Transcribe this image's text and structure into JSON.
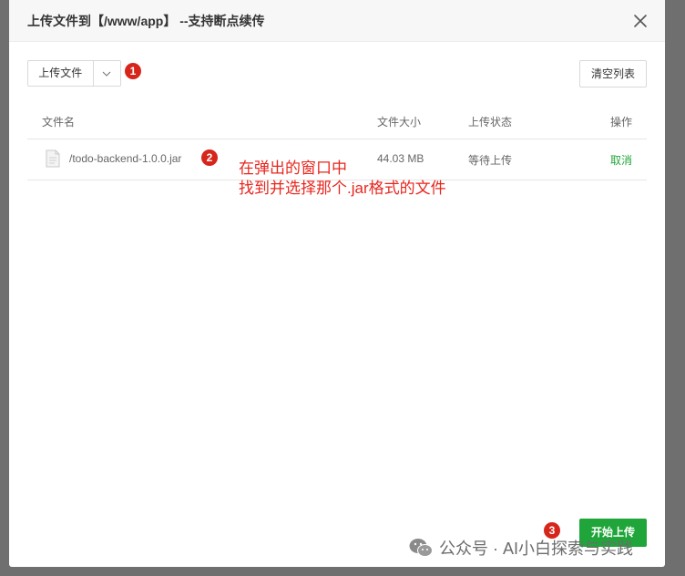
{
  "dialog": {
    "title": "上传文件到【/www/app】 --支持断点续传"
  },
  "toolbar": {
    "upload_label": "上传文件",
    "clear_label": "清空列表",
    "start_label": "开始上传"
  },
  "table": {
    "columns": [
      "文件名",
      "文件大小",
      "上传状态",
      "操作"
    ],
    "rows": [
      {
        "name": "/todo-backend-1.0.0.jar",
        "size": "44.03 MB",
        "status": "等待上传",
        "action": "取消"
      }
    ]
  },
  "annotations": {
    "badge1": "1",
    "badge2": "2",
    "badge3": "3",
    "note_line1": "在弹出的窗口中",
    "note_line2": "找到并选择那个.jar格式的文件"
  },
  "watermark": {
    "text": "公众号 · AI小白探索与实践"
  },
  "colors": {
    "accent_green": "#20a53a",
    "annotation_red": "#e8261e",
    "badge_red": "#d6261c"
  },
  "icons": {
    "close": "close-icon",
    "dropdown": "chevron-down-icon",
    "file": "file-icon",
    "wechat": "wechat-icon"
  }
}
